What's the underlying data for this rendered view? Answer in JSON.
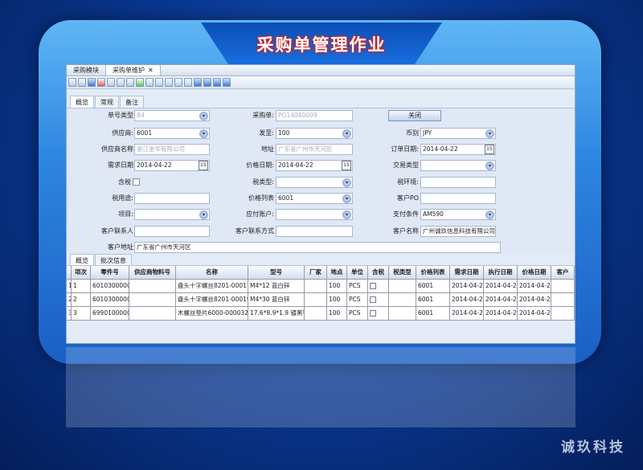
{
  "banner": {
    "title": "采购单管理作业"
  },
  "window_tabs": [
    {
      "label": "采购模块"
    },
    {
      "label": "采购单维护",
      "close": "✕"
    }
  ],
  "sub_tabs": [
    "概览",
    "常规",
    "备注"
  ],
  "form": {
    "order_type_label": "单号类型",
    "order_type_value": "B4",
    "po_label": "采购单:",
    "po_value": "PO14040009",
    "close_button": "关闭",
    "supplier_label": "供应商:",
    "supplier_value": "6001",
    "ship_label": "发至:",
    "ship_value": "100",
    "currency_label": "币别",
    "currency_value": "JPY",
    "supplier_name_label": "供应商名称",
    "supplier_name_value": "浙江金华有限公司",
    "address_label": "地址",
    "address_value": "广东省广州市天河区",
    "order_date_label": "订单日期:",
    "order_date_value": "2014-04-22",
    "need_date_label": "需求日期",
    "need_date_value": "2014-04-22",
    "price_date_label": "价格日期:",
    "price_date_value": "2014-04-22",
    "trade_type_label": "交易类型",
    "tax_incl_label": "含税",
    "tax_type_label": "税类型:",
    "tax_env_label": "税环境:",
    "tax_use_label": "税用途:",
    "price_list_label": "价格列表",
    "price_list_value": "6001",
    "customer_po_label": "客户PO",
    "project_label": "项目:",
    "ap_label": "应付账户:",
    "pay_terms_label": "支付条件",
    "pay_terms_value": "AM590",
    "contact_label": "客户联系人",
    "contact_method_label": "客户联系方式",
    "customer_name_label": "客户名称",
    "customer_name_value": "广州诚玖信息科技有限公司",
    "customer_addr_label": "客户地址",
    "customer_addr_value": "广东省广州市天河区",
    "cal_glyph": "15",
    "dd_glyph": "▾"
  },
  "grid_tabs": [
    "概览",
    "批次信息"
  ],
  "grid": {
    "headers": [
      "项次",
      "零件号",
      "供应商物料号",
      "名称",
      "型号",
      "厂家",
      "地点",
      "单位",
      "含税",
      "税类型",
      "价格列表",
      "需求日期",
      "执行日期",
      "价格日期",
      "客户"
    ],
    "rows": [
      {
        "idx": "1",
        "item": "1",
        "part": "6010300000006",
        "sup": "",
        "name": "盘头十字螺丝8201-000175",
        "model": "M4*12  蓝白锌",
        "maker": "",
        "loc": "100",
        "unit": "PCS",
        "tax": "",
        "taxtype": "",
        "pl": "6001",
        "need": "2014-04-22",
        "exec": "2014-04-22",
        "pdate": "2014-04-22",
        "cust": ""
      },
      {
        "idx": "2",
        "item": "2",
        "part": "6010300000007",
        "sup": "",
        "name": "盘头十字螺丝8201-000191",
        "model": "M4*30  蓝白锌",
        "maker": "",
        "loc": "100",
        "unit": "PCS",
        "tax": "",
        "taxtype": "",
        "pl": "6001",
        "need": "2014-04-22",
        "exec": "2014-04-22",
        "pdate": "2014-04-22",
        "cust": ""
      },
      {
        "idx": "3",
        "item": "3",
        "part": "6990100000011",
        "sup": "",
        "name": "木螺丝垫片6000-000032",
        "model": "17.6*8.9*1.9  镀黑锌",
        "maker": "",
        "loc": "100",
        "unit": "PCS",
        "tax": "",
        "taxtype": "",
        "pl": "6001",
        "need": "2014-04-22",
        "exec": "2014-04-22",
        "pdate": "2014-04-22",
        "cust": ""
      }
    ]
  },
  "watermark": "诚玖科技",
  "colors": {
    "accent": "#2e86e0",
    "title_outline": "#c22"
  }
}
